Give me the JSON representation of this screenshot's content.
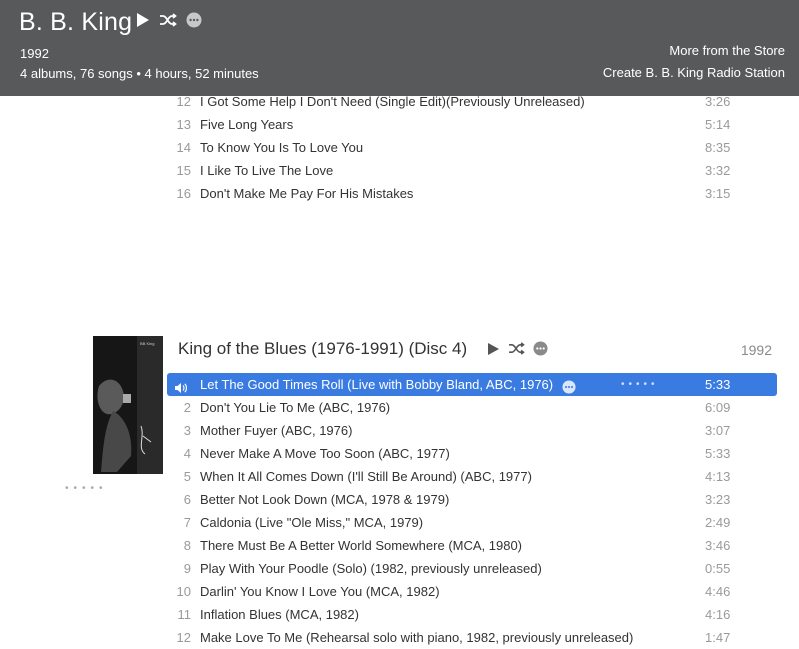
{
  "header": {
    "artist": "B. B. King",
    "year": "1992",
    "summary": "4 albums, 76 songs • 4 hours, 52 minutes",
    "more_link": "More from the Store",
    "radio_link": "Create B. B. King Radio Station"
  },
  "prev_album": {
    "tracks": [
      {
        "num": "12",
        "title": "I Got Some Help I Don't Need (Single Edit)(Previously Unreleased)",
        "dur": "3:26"
      },
      {
        "num": "13",
        "title": "Five Long Years",
        "dur": "5:14"
      },
      {
        "num": "14",
        "title": "To Know You Is To Love You",
        "dur": "8:35"
      },
      {
        "num": "15",
        "title": "I Like To Live The Love",
        "dur": "3:32"
      },
      {
        "num": "16",
        "title": "Don't Make Me Pay For His Mistakes",
        "dur": "3:15"
      }
    ]
  },
  "album": {
    "title": "King of the Blues (1976-1991) (Disc 4)",
    "year": "1992",
    "cover_caption": "BB King",
    "tracks": [
      {
        "num": "",
        "title": "Let The Good Times Roll (Live with Bobby Bland, ABC, 1976)",
        "dur": "5:33"
      },
      {
        "num": "2",
        "title": "Don't You Lie To Me (ABC, 1976)",
        "dur": "6:09"
      },
      {
        "num": "3",
        "title": "Mother Fuyer (ABC, 1976)",
        "dur": "3:07"
      },
      {
        "num": "4",
        "title": "Never Make A Move Too Soon (ABC, 1977)",
        "dur": "5:33"
      },
      {
        "num": "5",
        "title": "When It All Comes Down (I'll Still Be Around)  (ABC, 1977)",
        "dur": "4:13"
      },
      {
        "num": "6",
        "title": "Better Not Look Down (MCA, 1978 & 1979)",
        "dur": "3:23"
      },
      {
        "num": "7",
        "title": "Caldonia (Live \"Ole Miss,\" MCA, 1979)",
        "dur": "2:49"
      },
      {
        "num": "8",
        "title": "There Must Be A Better World Somewhere (MCA, 1980)",
        "dur": "3:46"
      },
      {
        "num": "9",
        "title": "Play With Your Poodle (Solo) (1982, previously unreleased)",
        "dur": "0:55"
      },
      {
        "num": "10",
        "title": "Darlin' You Know I Love You (MCA, 1982)",
        "dur": "4:46"
      },
      {
        "num": "11",
        "title": "Inflation Blues (MCA, 1982)",
        "dur": "4:16"
      },
      {
        "num": "12",
        "title": "Make Love To Me (Rehearsal solo with piano, 1982, previously unreleased)",
        "dur": "1:47"
      }
    ]
  },
  "icons": {
    "play": "play-icon",
    "shuffle": "shuffle-icon",
    "more": "more-icon",
    "speaker": "speaker-icon"
  },
  "colors": {
    "header_bg": "#58595b",
    "selection": "#3a7be2"
  }
}
